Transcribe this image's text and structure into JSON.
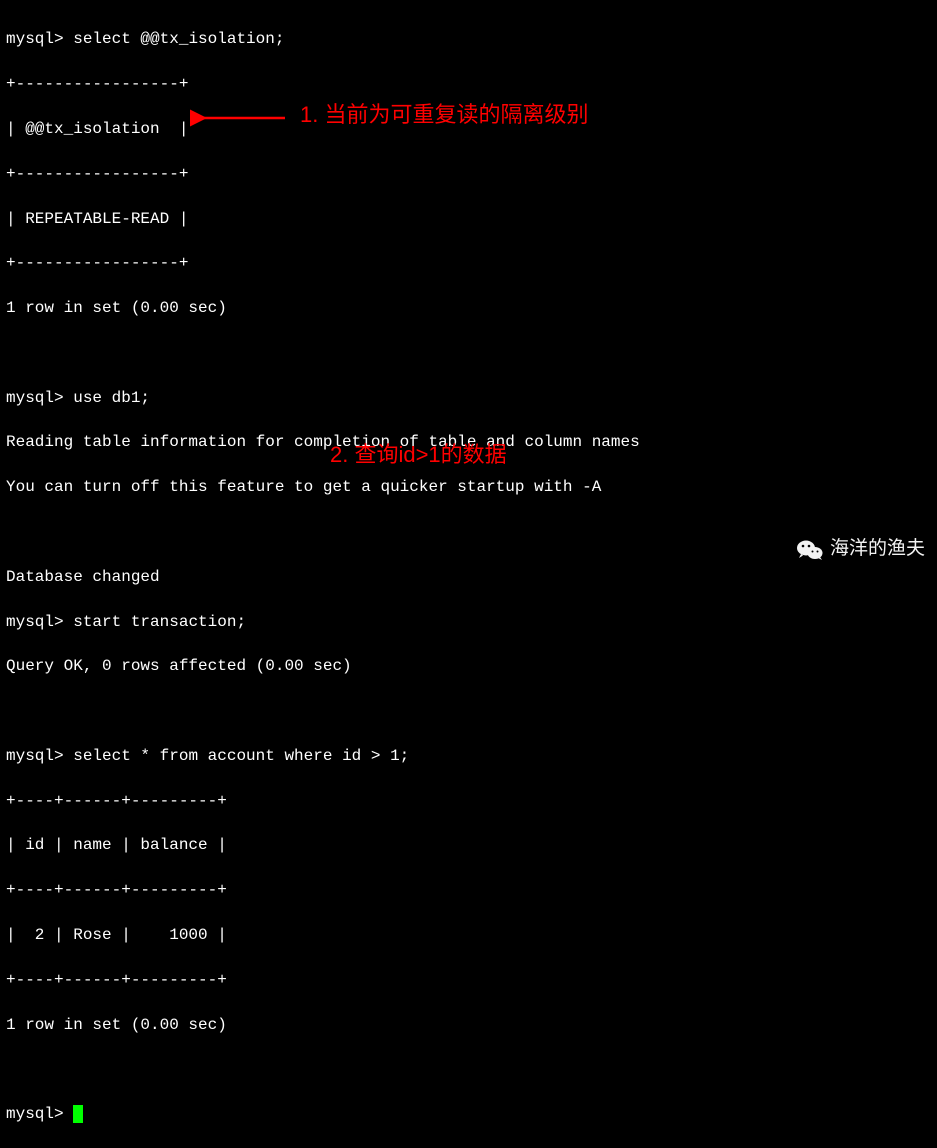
{
  "terminal": {
    "prompt": "mysql>",
    "cmd1": "select @@tx_isolation;",
    "border1_top": "+-----------------+",
    "header1": "| @@tx_isolation  |",
    "border1_mid": "+-----------------+",
    "row1": "| REPEATABLE-READ |",
    "border1_bot": "+-----------------+",
    "result1": "1 row in set (0.00 sec)",
    "cmd2": "use db1;",
    "msg1": "Reading table information for completion of table and column names",
    "msg2": "You can turn off this feature to get a quicker startup with -A",
    "msg3": "Database changed",
    "cmd3": "start transaction;",
    "result2": "Query OK, 0 rows affected (0.00 sec)",
    "cmd4": "select * from account where id > 1;",
    "border2_top": "+----+------+---------+",
    "header2": "| id | name | balance |",
    "border2_mid": "+----+------+---------+",
    "row2": "|  2 | Rose |    1000 |",
    "border2_bot": "+----+------+---------+",
    "result3": "1 row in set (0.00 sec)"
  },
  "annotations": {
    "note1": "1. 当前为可重复读的隔离级别",
    "note2": "2. 查询id>1的数据"
  },
  "watermark": {
    "text": "海洋的渔夫"
  },
  "chart_data": {
    "type": "table",
    "tables": [
      {
        "query": "select @@tx_isolation;",
        "columns": [
          "@@tx_isolation"
        ],
        "rows": [
          [
            "REPEATABLE-READ"
          ]
        ],
        "footer": "1 row in set (0.00 sec)"
      },
      {
        "query": "select * from account where id > 1;",
        "columns": [
          "id",
          "name",
          "balance"
        ],
        "rows": [
          [
            2,
            "Rose",
            1000
          ]
        ],
        "footer": "1 row in set (0.00 sec)"
      }
    ]
  }
}
